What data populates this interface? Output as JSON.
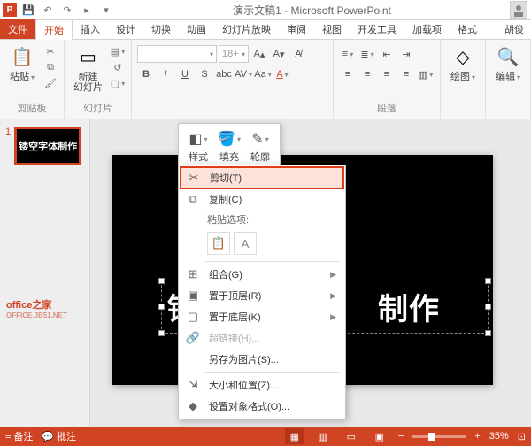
{
  "titlebar": {
    "title": "演示文稿1 - Microsoft PowerPoint",
    "app_icon_text": "P"
  },
  "tabs": {
    "file": "文件",
    "home": "开始",
    "insert": "插入",
    "design": "设计",
    "transitions": "切换",
    "animations": "动画",
    "slideshow": "幻灯片放映",
    "review": "审阅",
    "view": "视图",
    "developer": "开发工具",
    "addins": "加载项",
    "format": "格式",
    "user": "胡俊"
  },
  "ribbon": {
    "clipboard": {
      "label": "剪贴板",
      "paste": "粘贴"
    },
    "slides": {
      "label": "幻灯片",
      "new_slide": "新建\n幻灯片"
    },
    "font": {
      "size": "18+",
      "bold": "B",
      "italic": "I",
      "underline": "U",
      "shadow": "S"
    },
    "paragraph": {
      "label": "段落"
    },
    "drawing": {
      "label": "绘图"
    },
    "editing": {
      "label": "编辑"
    }
  },
  "mini_toolbar": {
    "style": "样式",
    "fill": "填充",
    "outline": "轮廓"
  },
  "context_menu": {
    "cut": "剪切(T)",
    "copy": "复制(C)",
    "paste_options": "粘贴选项:",
    "group": "组合(G)",
    "bring_front": "置于顶层(R)",
    "send_back": "置于底层(K)",
    "hyperlink": "超链接(H)...",
    "save_as_pic": "另存为图片(S)...",
    "size_pos": "大小和位置(Z)...",
    "format_obj": "设置对象格式(O)..."
  },
  "slide": {
    "text": "镂空字体制作",
    "text_left": "镂",
    "text_right": "制作"
  },
  "thumbnail": {
    "number": "1",
    "text": "镂空字体制作"
  },
  "watermark": {
    "main": "office之家",
    "sub": "OFFICE.JB51.NET"
  },
  "statusbar": {
    "notes": "备注",
    "comments": "批注",
    "zoom": "35%"
  }
}
